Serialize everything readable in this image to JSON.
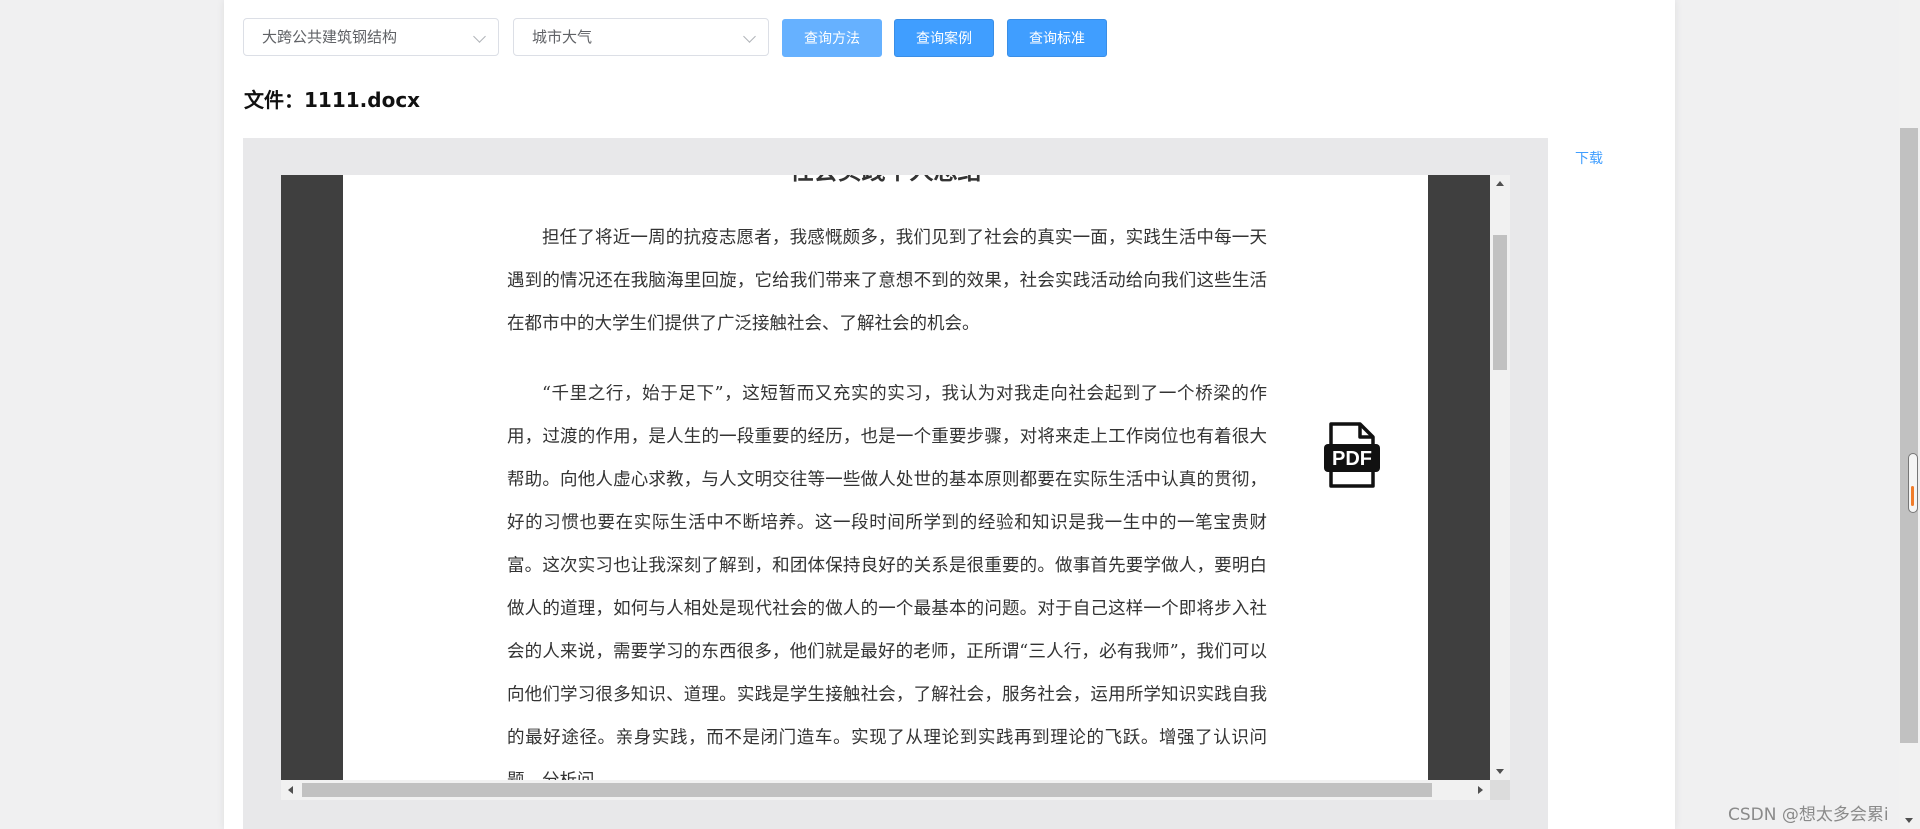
{
  "toolbar": {
    "select_structure": {
      "value": "大跨公共建筑钢结构"
    },
    "select_environment": {
      "value": "城市大气"
    },
    "query_method_label": "查询方法",
    "query_case_label": "查询案例",
    "query_standard_label": "查询标准"
  },
  "file": {
    "title": "文件：1111.docx"
  },
  "download_label": "下载",
  "document": {
    "heading": "社会实践个人总结",
    "paragraphs": [
      "担任了将近一周的抗疫志愿者，我感慨颇多，我们见到了社会的真实一面，实践生活中每一天遇到的情况还在我脑海里回旋，它给我们带来了意想不到的效果，社会实践活动给向我们这些生活在都市中的大学生们提供了广泛接触社会、了解社会的机会。",
      "“千里之行，始于足下”，这短暂而又充实的实习，我认为对我走向社会起到了一个桥梁的作用，过渡的作用，是人生的一段重要的经历，也是一个重要步骤，对将来走上工作岗位也有着很大帮助。向他人虚心求教，与人文明交往等一些做人处世的基本原则都要在实际生活中认真的贯彻，好的习惯也要在实际生活中不断培养。这一段时间所学到的经验和知识是我一生中的一笔宝贵财富。这次实习也让我深刻了解到，和团体保持良好的关系是很重要的。做事首先要学做人，要明白做人的道理，如何与人相处是现代社会的做人的一个最基本的问题。对于自己这样一个即将步入社会的人来说，需要学习的东西很多，他们就是最好的老师，正所谓“三人行，必有我师”，我们可以向他们学习很多知识、道理。实践是学生接触社会，了解社会，服务社会，运用所学知识实践自我的最好途径。亲身实践，而不是闭门造车。实现了从理论到实践再到理论的飞跃。增强了认识问题，分析问"
    ],
    "pdf_icon_text": "PDF"
  },
  "watermark": "CSDN @想太多会累i",
  "icons": {
    "select_chevron": "chevron-down-icon",
    "pdf": "pdf-file-icon"
  },
  "colors": {
    "primary": "#409eff",
    "primary_light": "#66b1ff",
    "viewer_bg": "#3f3f3f"
  }
}
